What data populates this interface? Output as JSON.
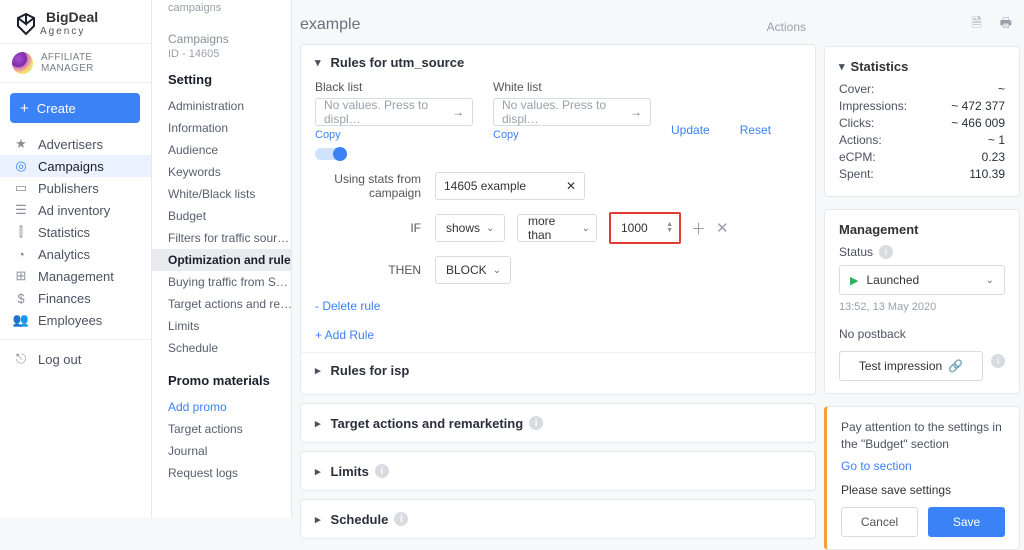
{
  "brand": {
    "name": "BigDeal",
    "sub": "Agency"
  },
  "user": {
    "role": "AFFILIATE MANAGER"
  },
  "create_btn": "Create",
  "nav": {
    "items": [
      {
        "icon": "★",
        "label": "Advertisers"
      },
      {
        "icon": "◎",
        "label": "Campaigns"
      },
      {
        "icon": "▭",
        "label": "Publishers"
      },
      {
        "icon": "☰",
        "label": "Ad inventory"
      },
      {
        "icon": "⫿",
        "label": "Statistics"
      },
      {
        "icon": "◔",
        "label": "Analytics"
      },
      {
        "icon": "⊞",
        "label": "Management"
      },
      {
        "icon": "$",
        "label": "Finances"
      },
      {
        "icon": "👥",
        "label": "Employees"
      }
    ],
    "logout": {
      "icon": "⎋",
      "label": "Log out"
    },
    "active_index": 1
  },
  "subnav": {
    "crumb": "campaigns",
    "group_title": "Campaigns",
    "group_sub": "ID - 14605",
    "heading": "Setting",
    "items": [
      "Administration",
      "Information",
      "Audience",
      "Keywords",
      "White/Black lists",
      "Budget",
      "Filters for traffic sour…",
      "Optimization and rules",
      "Buying traffic from S…",
      "Target actions and re…",
      "Limits",
      "Schedule"
    ],
    "active_index": 7,
    "promo_head": "Promo materials",
    "add_promo": "Add promo",
    "extras": [
      "Target actions",
      "Journal",
      "Request logs"
    ]
  },
  "page": {
    "title": "example",
    "actions_label": "Actions"
  },
  "rules": {
    "head": "Rules for utm_source",
    "blacklist_label": "Black list",
    "whitelist_label": "White list",
    "placeholder": "No values. Press to displ…",
    "copy": "Copy",
    "update": "Update",
    "reset": "Reset",
    "using_stats": "Using stats from campaign",
    "campaign_value": "14605 example",
    "if_label": "IF",
    "if_metric": "shows",
    "if_op": "more than",
    "if_value": "1000",
    "then_label": "THEN",
    "then_action": "BLOCK",
    "delete_rule": "- Delete rule",
    "add_rule": "+ Add Rule",
    "isp_head": "Rules for isp"
  },
  "accordions": [
    "Target actions and remarketing",
    "Limits",
    "Schedule"
  ],
  "stats": {
    "head": "Statistics",
    "rows": [
      {
        "k": "Cover:",
        "v": "~"
      },
      {
        "k": "Impressions:",
        "v": "~ 472 377"
      },
      {
        "k": "Clicks:",
        "v": "~ 466 009"
      },
      {
        "k": "Actions:",
        "v": "~ 1"
      },
      {
        "k": "eCPM:",
        "v": "0.23"
      },
      {
        "k": "Spent:",
        "v": "110.39"
      }
    ]
  },
  "management": {
    "head": "Management",
    "status_label": "Status",
    "status_value": "Launched",
    "timestamp": "13:52, 13 May 2020",
    "no_postback": "No postback",
    "test_impression": "Test impression"
  },
  "alert": {
    "msg": "Pay attention to the settings in the \"Budget\" section",
    "go": "Go to section",
    "prompt": "Please save settings",
    "cancel": "Cancel",
    "save": "Save"
  }
}
